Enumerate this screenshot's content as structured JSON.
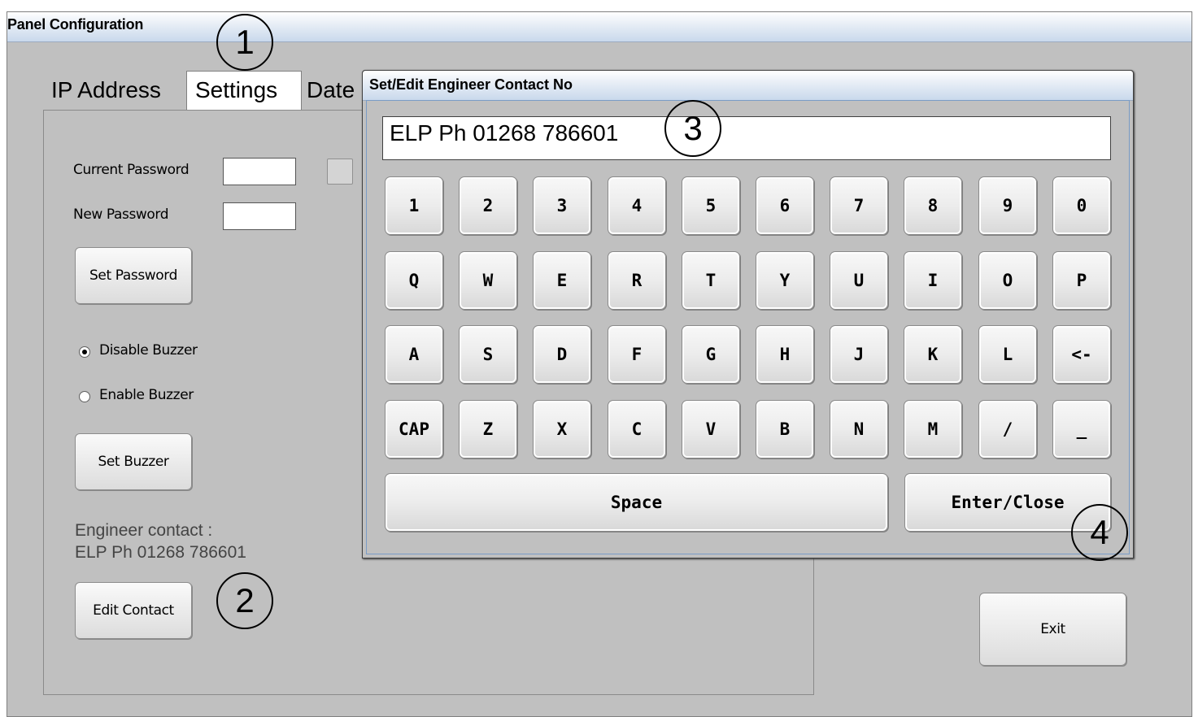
{
  "main_window": {
    "title": "Panel Configuration",
    "tabs": [
      {
        "label": "IP Address"
      },
      {
        "label": "Settings"
      },
      {
        "label": "Date"
      }
    ],
    "settings": {
      "current_password_label": "Current Password",
      "new_password_label": "New Password",
      "set_password_label": "Set Password",
      "disable_buzzer_label": "Disable Buzzer",
      "enable_buzzer_label": "Enable Buzzer",
      "buzzer_selected": "Disable Buzzer",
      "set_buzzer_label": "Set Buzzer",
      "engineer_contact_heading": "Engineer contact :",
      "engineer_contact_value": "ELP Ph 01268 786601",
      "edit_contact_label": "Edit Contact"
    },
    "exit_label": "Exit"
  },
  "dialog": {
    "title": "Set/Edit Engineer Contact No",
    "input_value": "ELP Ph 01268 786601",
    "keyboard_rows": [
      [
        "1",
        "2",
        "3",
        "4",
        "5",
        "6",
        "7",
        "8",
        "9",
        "0"
      ],
      [
        "Q",
        "W",
        "E",
        "R",
        "T",
        "Y",
        "U",
        "I",
        "O",
        "P"
      ],
      [
        "A",
        "S",
        "D",
        "F",
        "G",
        "H",
        "J",
        "K",
        "L",
        "<-"
      ],
      [
        "CAP",
        "Z",
        "X",
        "C",
        "V",
        "B",
        "N",
        "M",
        "/",
        "_"
      ]
    ],
    "space_label": "Space",
    "enter_close_label": "Enter/Close"
  },
  "annotations": [
    "1",
    "2",
    "3",
    "4"
  ]
}
